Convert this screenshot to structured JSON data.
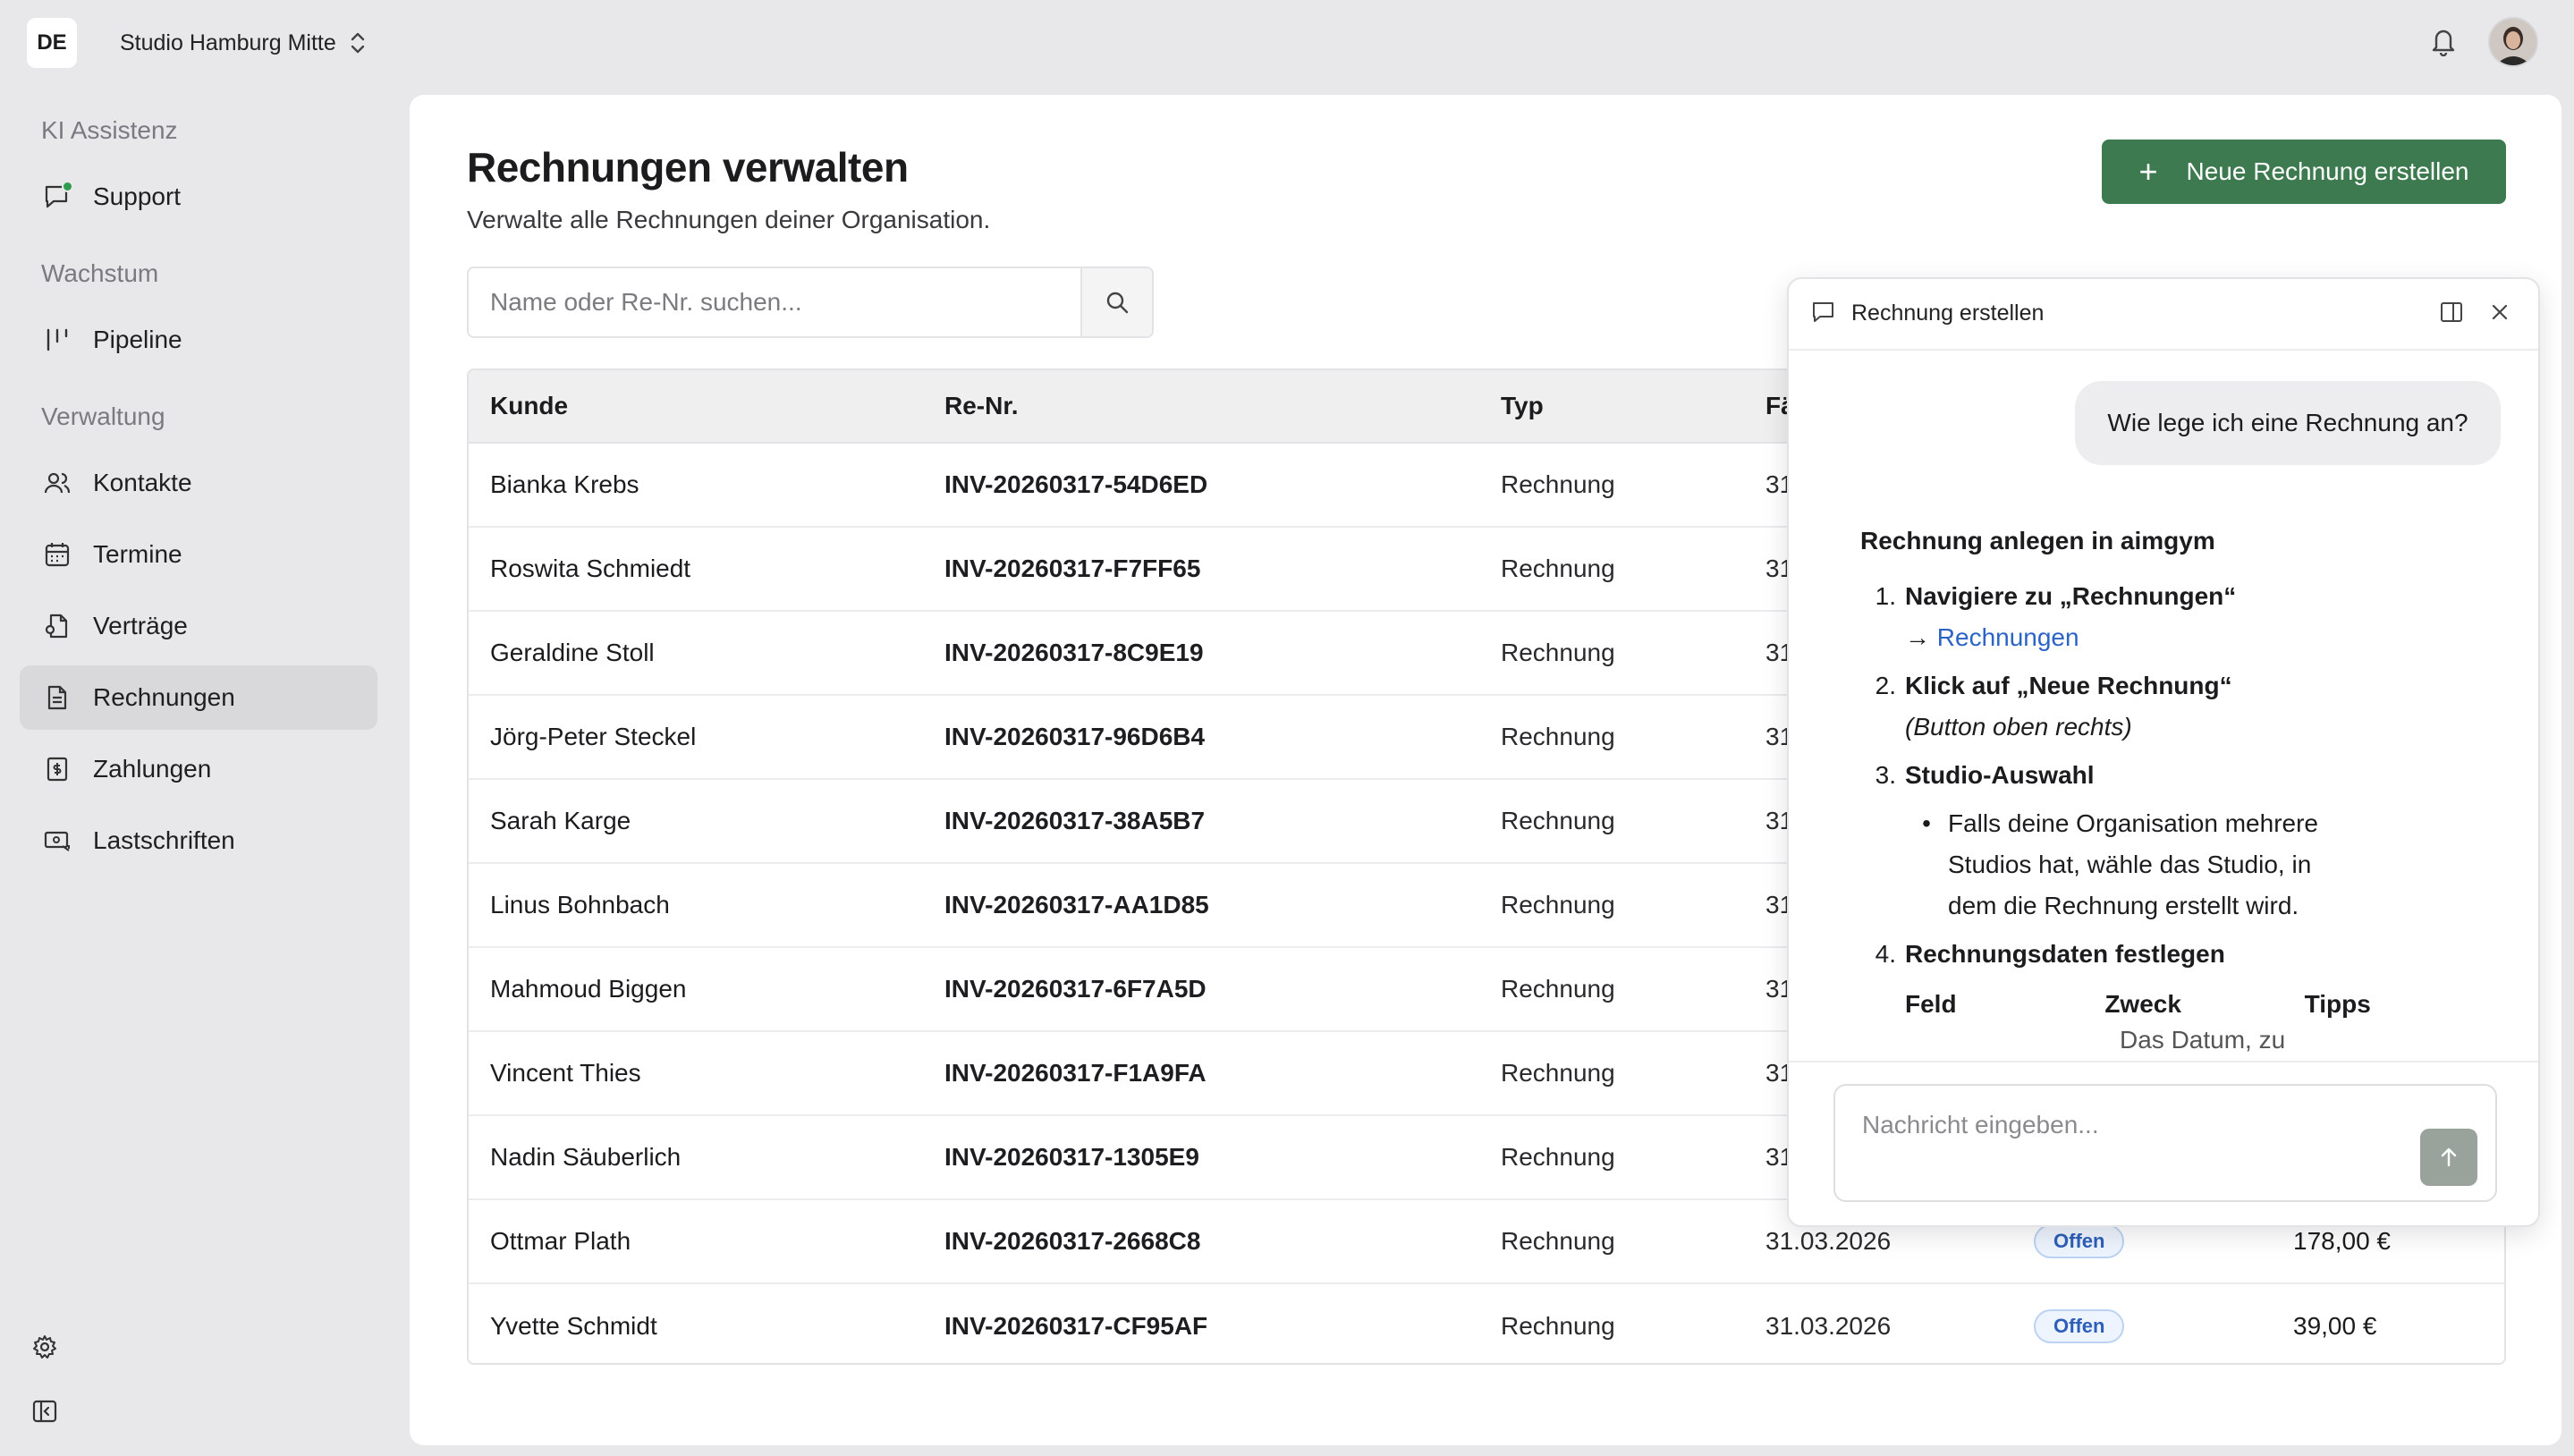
{
  "header": {
    "org_initials": "DE",
    "studio_name": "Studio Hamburg Mitte"
  },
  "sidebar": {
    "sections": [
      {
        "label": "KI Assistenz"
      },
      {
        "label": "Wachstum"
      },
      {
        "label": "Verwaltung"
      }
    ],
    "items": [
      {
        "label": "Support"
      },
      {
        "label": "Pipeline"
      },
      {
        "label": "Kontakte"
      },
      {
        "label": "Termine"
      },
      {
        "label": "Verträge"
      },
      {
        "label": "Rechnungen"
      },
      {
        "label": "Zahlungen"
      },
      {
        "label": "Lastschriften"
      }
    ]
  },
  "main": {
    "title": "Rechnungen verwalten",
    "subtitle": "Verwalte alle Rechnungen deiner Organisation.",
    "new_button_label": "Neue Rechnung erstellen",
    "search_placeholder": "Name oder Re-Nr. suchen...",
    "table": {
      "headers": [
        "Kunde",
        "Re-Nr.",
        "Typ",
        "Fä"
      ],
      "rows": [
        {
          "kunde": "Bianka Krebs",
          "renr": "INV-20260317-54D6ED",
          "typ": "Rechnung",
          "faellig": "31",
          "status": "",
          "betrag": ""
        },
        {
          "kunde": "Roswita Schmiedt",
          "renr": "INV-20260317-F7FF65",
          "typ": "Rechnung",
          "faellig": "31",
          "status": "",
          "betrag": ""
        },
        {
          "kunde": "Geraldine Stoll",
          "renr": "INV-20260317-8C9E19",
          "typ": "Rechnung",
          "faellig": "31",
          "status": "",
          "betrag": ""
        },
        {
          "kunde": "Jörg-Peter Steckel",
          "renr": "INV-20260317-96D6B4",
          "typ": "Rechnung",
          "faellig": "31",
          "status": "",
          "betrag": ""
        },
        {
          "kunde": "Sarah Karge",
          "renr": "INV-20260317-38A5B7",
          "typ": "Rechnung",
          "faellig": "31",
          "status": "",
          "betrag": ""
        },
        {
          "kunde": "Linus Bohnbach",
          "renr": "INV-20260317-AA1D85",
          "typ": "Rechnung",
          "faellig": "31",
          "status": "",
          "betrag": ""
        },
        {
          "kunde": "Mahmoud Biggen",
          "renr": "INV-20260317-6F7A5D",
          "typ": "Rechnung",
          "faellig": "31",
          "status": "",
          "betrag": ""
        },
        {
          "kunde": "Vincent Thies",
          "renr": "INV-20260317-F1A9FA",
          "typ": "Rechnung",
          "faellig": "31",
          "status": "",
          "betrag": ""
        },
        {
          "kunde": "Nadin Säuberlich",
          "renr": "INV-20260317-1305E9",
          "typ": "Rechnung",
          "faellig": "31",
          "status": "",
          "betrag": ""
        },
        {
          "kunde": "Ottmar Plath",
          "renr": "INV-20260317-2668C8",
          "typ": "Rechnung",
          "faellig": "31.03.2026",
          "status": "Offen",
          "betrag": "178,00 €"
        },
        {
          "kunde": "Yvette Schmidt",
          "renr": "INV-20260317-CF95AF",
          "typ": "Rechnung",
          "faellig": "31.03.2026",
          "status": "Offen",
          "betrag": "39,00 €"
        }
      ]
    }
  },
  "chat": {
    "title": "Rechnung erstellen",
    "user_message": "Wie lege ich eine Rechnung an?",
    "answer_heading": "Rechnung anlegen in aimgym",
    "step1_num": "1.",
    "step1_title": "Navigiere zu „Rechnungen“",
    "step1_arrow": "→ ",
    "step1_link": "Rechnungen",
    "step2_num": "2.",
    "step2_title": "Klick auf „Neue Rechnung“",
    "step2_note": "(Button oben rechts)",
    "step3_num": "3.",
    "step3_title": "Studio-Auswahl",
    "step3_bullet": "Falls deine Organisation mehrere Studios hat, wähle das Studio, in dem die Rechnung erstellt wird.",
    "step4_num": "4.",
    "step4_title": "Rechnungsdaten festlegen",
    "table_headers": [
      "Feld",
      "Zweck",
      "Tipps"
    ],
    "cut_text": "Das Datum, zu",
    "input_placeholder": "Nachricht eingeben..."
  },
  "colors": {
    "primary_green": "#3d7a4f",
    "badge_blue": "#2d5fb8",
    "link_blue": "#2b63c6",
    "online_dot": "#2e9b4e"
  }
}
